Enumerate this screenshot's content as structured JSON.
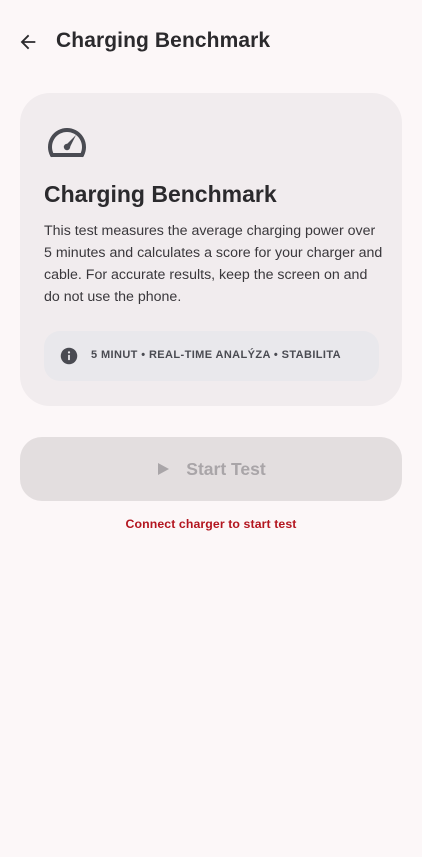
{
  "appbar": {
    "title": "Charging Benchmark",
    "back_icon": "arrow-left-icon"
  },
  "card": {
    "icon": "speedometer-icon",
    "title": "Charging Benchmark",
    "description": "This test measures the average charging power over 5 minutes and calculates a score for your charger and cable. For accurate results, keep the screen on and do not use the phone.",
    "info": {
      "icon": "info-icon",
      "text": "5 MINUT • REAL-TIME ANALÝZA • STABILITA"
    }
  },
  "start_button": {
    "icon": "play-icon",
    "label": "Start Test",
    "enabled": false
  },
  "status": {
    "warning": "Connect charger to start test",
    "color": "#b3151f"
  },
  "colors": {
    "background": "#fcf7f8",
    "card": "#f1ecee",
    "pill": "#e9e8ec",
    "button_disabled": "#e3dedf"
  }
}
